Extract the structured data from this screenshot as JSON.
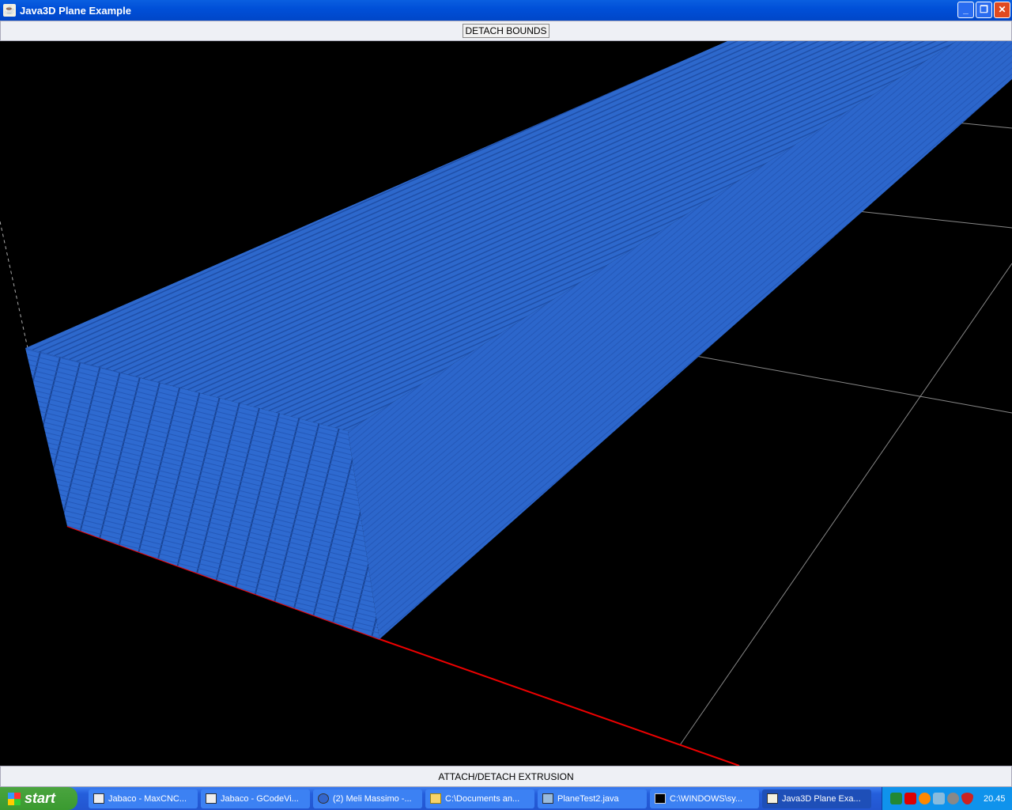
{
  "window": {
    "title": "Java3D Plane Example",
    "minimize": "_",
    "maximize": "❐",
    "close": "✕"
  },
  "top_button": "DETACH BOUNDS",
  "bottom_button": "ATTACH/DETACH EXTRUSION",
  "scene": {
    "box_color": "#2b66c9",
    "background": "#000000"
  },
  "taskbar": {
    "start": "start",
    "tasks": [
      {
        "label": "Jabaco - MaxCNC...",
        "icon": "window-icon"
      },
      {
        "label": "Jabaco - GCodeVi...",
        "icon": "window-icon"
      },
      {
        "label": "(2) Meli Massimo -...",
        "icon": "messenger-icon"
      },
      {
        "label": "C:\\Documents an...",
        "icon": "folder-icon"
      },
      {
        "label": "PlaneTest2.java",
        "icon": "editor-icon"
      },
      {
        "label": "C:\\WINDOWS\\sy...",
        "icon": "console-icon"
      },
      {
        "label": "Java3D Plane Exa...",
        "icon": "java-icon",
        "active": true
      }
    ],
    "clock": "20.45"
  }
}
